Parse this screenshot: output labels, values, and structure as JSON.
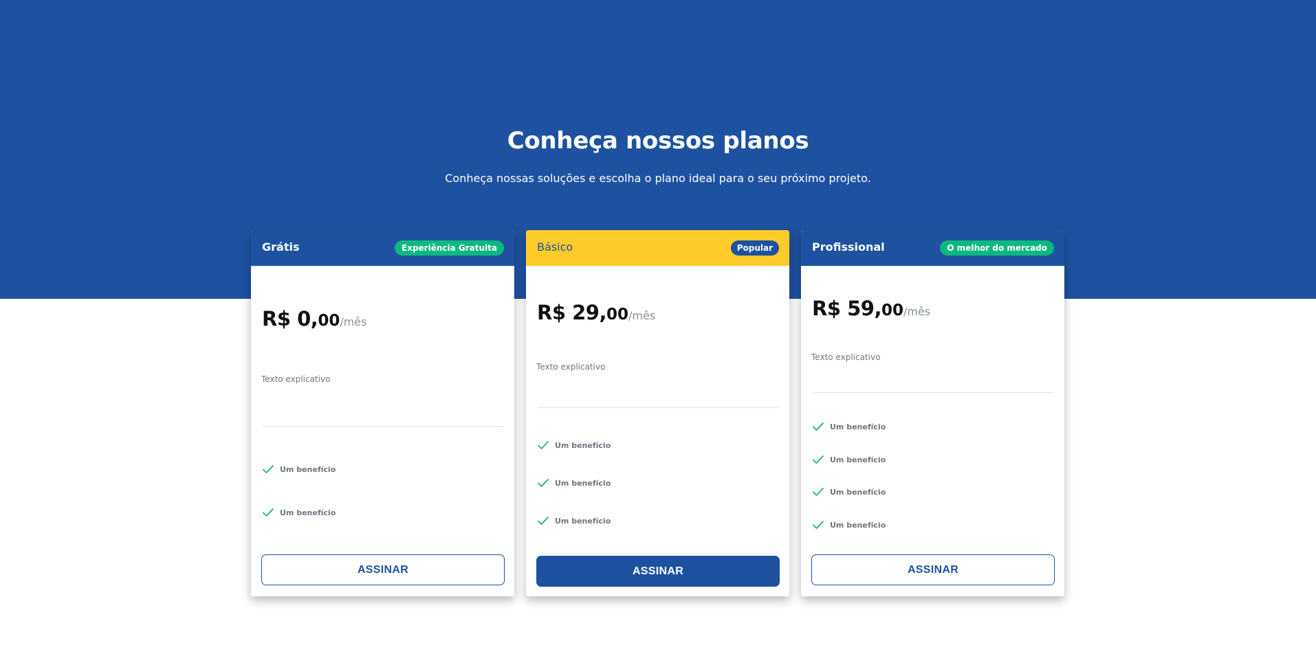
{
  "hero": {
    "title": "Conheça nossos planos",
    "subtitle": "Conheça nossas soluções e escolha o plano ideal para o seu próximo projeto."
  },
  "colors": {
    "primary": "#1e52a0",
    "highlight": "#ffcb2b",
    "badge_green": "#0cb87d",
    "check_green": "#22b07d"
  },
  "plans": [
    {
      "name": "Grátis",
      "badge": "Experiência Gratuita",
      "price_main": "R$ 0,",
      "price_cents": "00",
      "price_period": "/mês",
      "description": "Texto explicativo",
      "benefits": [
        "Um benefício",
        "Um benefício"
      ],
      "button_label": "ASSINAR"
    },
    {
      "name": "Básico",
      "badge": "Popular",
      "price_main": "R$ 29,",
      "price_cents": "00",
      "price_period": "/mês",
      "description": "Texto explicativo",
      "benefits": [
        "Um benefício",
        "Um benefício",
        "Um benefício"
      ],
      "button_label": "ASSINAR"
    },
    {
      "name": "Profissional",
      "badge": "O melhor do mercado",
      "price_main": "R$ 59,",
      "price_cents": "00",
      "price_period": "/mês",
      "description": "Texto explicativo",
      "benefits": [
        "Um benefício",
        "Um benefício",
        "Um benefício",
        "Um benefício"
      ],
      "button_label": "ASSINAR"
    }
  ]
}
